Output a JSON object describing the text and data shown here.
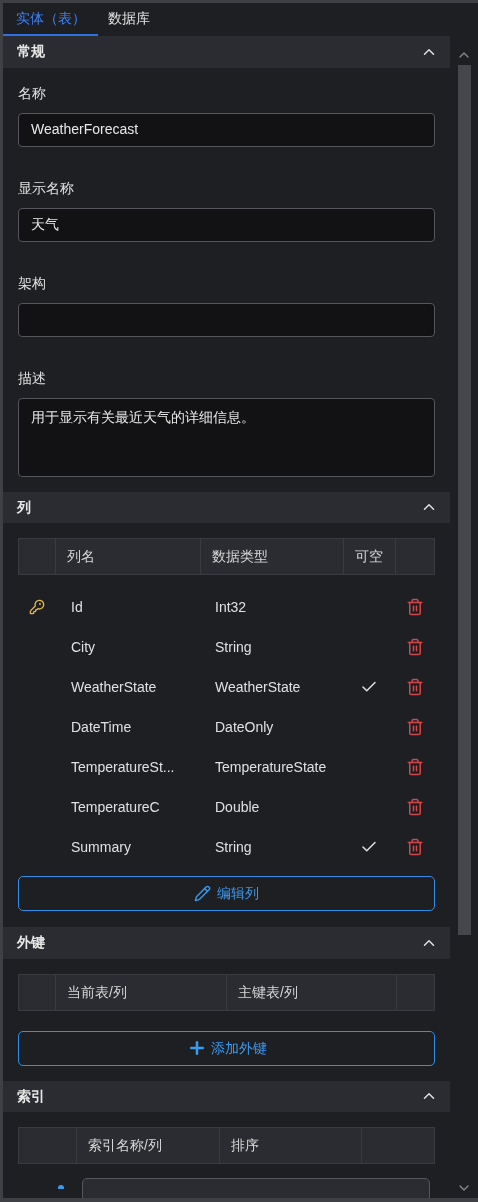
{
  "tabs": [
    {
      "label": "实体（表）",
      "selected": true
    },
    {
      "label": "数据库",
      "selected": false
    }
  ],
  "general": {
    "title": "常规",
    "expanded": true,
    "fields": [
      {
        "label": "名称",
        "value": "WeatherForecast",
        "kind": "input"
      },
      {
        "label": "显示名称",
        "value": "天气",
        "kind": "input"
      },
      {
        "label": "架构",
        "kind": "input"
      },
      {
        "label": "描述",
        "value": "用于显示有关最近天气的详细信息。",
        "kind": "textarea"
      }
    ]
  },
  "columns": {
    "title": "列",
    "expanded": true,
    "headers": [
      "列名",
      "数据类型",
      "可空"
    ],
    "rows": [
      {
        "primary_key": true,
        "name": "Id",
        "type": "Int32",
        "nullable": false
      },
      {
        "primary_key": false,
        "name": "City",
        "type": "String",
        "nullable": false
      },
      {
        "primary_key": false,
        "name": "WeatherState",
        "type": "WeatherState",
        "nullable": true
      },
      {
        "primary_key": false,
        "name": "DateTime",
        "type": "DateOnly",
        "nullable": false
      },
      {
        "primary_key": false,
        "name": "TemperatureSt...",
        "type": "TemperatureState",
        "nullable": false
      },
      {
        "primary_key": false,
        "name": "TemperatureC",
        "type": "Double",
        "nullable": false
      },
      {
        "primary_key": false,
        "name": "Summary",
        "type": "String",
        "nullable": true
      }
    ],
    "button": "编辑列"
  },
  "foreign_keys": {
    "title": "外键",
    "expanded": true,
    "headers": [
      "当前表/列",
      "主键表/列"
    ],
    "button": "添加外键"
  },
  "indexes": {
    "title": "索引",
    "expanded": true,
    "headers": [
      "索引名称/列",
      "排序"
    ]
  }
}
